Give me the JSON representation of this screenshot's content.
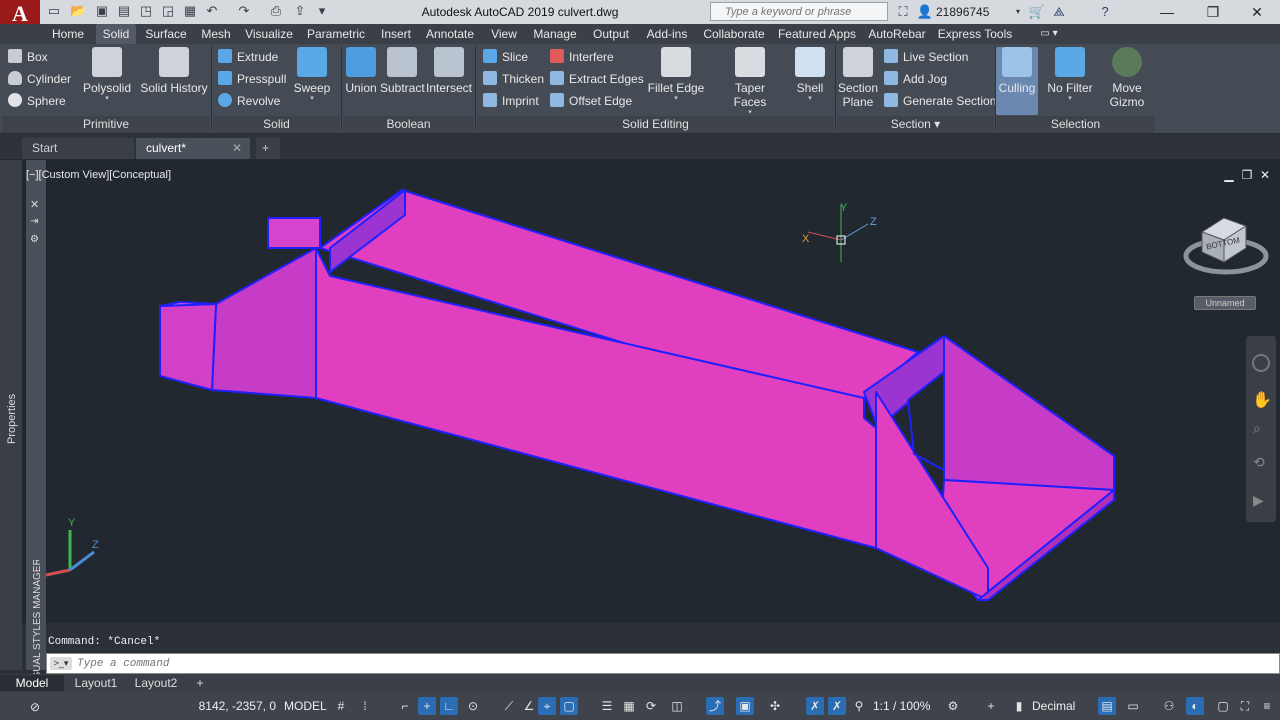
{
  "title_bar": {
    "app_logo": "A",
    "title": "Autodesk AutoCAD 2019    culvert.dwg",
    "search_placeholder": "Type a keyword or phrase",
    "user": "21896745"
  },
  "ribbon_tabs": [
    "Home",
    "Solid",
    "Surface",
    "Mesh",
    "Visualize",
    "Parametric",
    "Insert",
    "Annotate",
    "View",
    "Manage",
    "Output",
    "Add-ins",
    "Collaborate",
    "Featured Apps",
    "AutoRebar",
    "Express Tools"
  ],
  "active_tab": "Solid",
  "ribbon": {
    "primitive": {
      "title": "Primitive",
      "box": "Box",
      "cylinder": "Cylinder",
      "sphere": "Sphere",
      "polysolid": "Polysolid",
      "solid_history": "Solid History"
    },
    "solid": {
      "title": "Solid",
      "extrude": "Extrude",
      "presspull": "Presspull",
      "revolve": "Revolve",
      "sweep": "Sweep"
    },
    "boolean": {
      "title": "Boolean",
      "union": "Union",
      "subtract": "Subtract",
      "intersect": "Intersect"
    },
    "solid_editing": {
      "title": "Solid Editing",
      "slice": "Slice",
      "thicken": "Thicken",
      "imprint": "Imprint",
      "interfere": "Interfere",
      "extract_edges": "Extract Edges",
      "offset_edge": "Offset Edge",
      "fillet_edge": "Fillet Edge",
      "taper_faces": "Taper Faces",
      "shell": "Shell"
    },
    "section": {
      "title": "Section",
      "section_plane_1": "Section",
      "section_plane_2": "Plane",
      "live_section": "Live Section",
      "add_jog": "Add Jog",
      "generate_section": "Generate Section"
    },
    "selection": {
      "title": "Selection",
      "culling": "Culling",
      "no_filter": "No Filter",
      "move_gizmo_1": "Move",
      "move_gizmo_2": "Gizmo"
    }
  },
  "file_tabs": {
    "start": "Start",
    "current": "culvert*"
  },
  "viewport": {
    "label": "[−][Custom View][Conceptual]",
    "viewcube_face": "BOTTOM",
    "named_view": "Unnamed",
    "ucs_x": "X",
    "ucs_y": "Y",
    "ucs_z": "Z",
    "colors": {
      "solid_face": "#e040c0",
      "solid_face_dark": "#b030b8",
      "edge": "#2020ff",
      "background": "#212830"
    }
  },
  "side_panels": {
    "properties": "Properties",
    "visual_styles": "VISUAL STYLES MANAGER"
  },
  "command": {
    "history": "Command: *Cancel*",
    "placeholder": "Type a command"
  },
  "layout_tabs": [
    "Model",
    "Layout1",
    "Layout2"
  ],
  "status": {
    "coords": "8142, -2357, 0",
    "model": "MODEL",
    "scale": "1:1 / 100%",
    "units": "Decimal"
  }
}
